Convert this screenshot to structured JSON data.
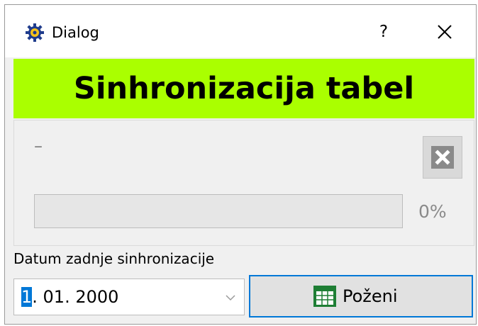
{
  "window": {
    "title": "Dialog",
    "help_label": "?",
    "icons": {
      "app": "gear-icon",
      "close": "close-icon"
    }
  },
  "banner": {
    "title": "Sinhronizacija tabel",
    "color": "#aaff00"
  },
  "progress": {
    "status_text": "–",
    "value": 0,
    "percent_label": "0%",
    "cancel_icon": "cancel-x-icon"
  },
  "sync": {
    "date_label": "Datum zadnje sinhronizacije",
    "date_selected_part": "1",
    "date_rest": ". 01. 2000",
    "run_label": "Poženi",
    "run_icon": "calendar-grid-icon",
    "accent_color": "#0078d7"
  }
}
